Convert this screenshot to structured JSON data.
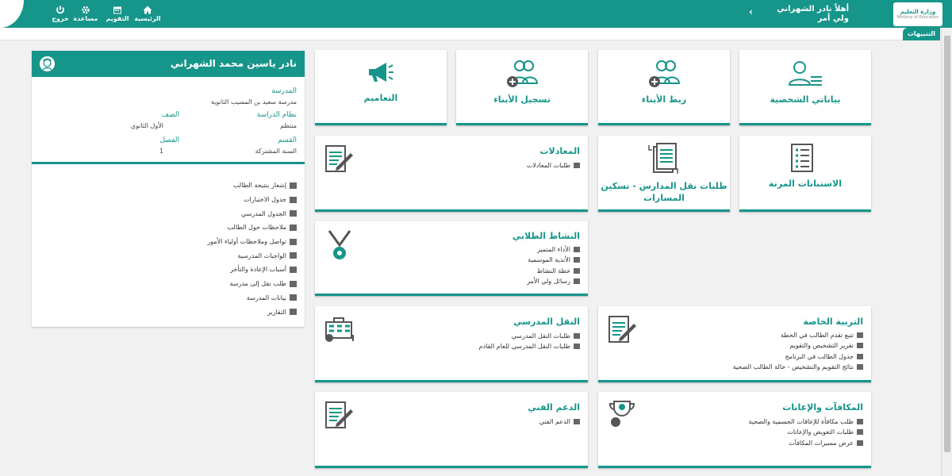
{
  "header": {
    "user_name": "أهلاً نادر الشهراني",
    "user_role": "ولي أمر",
    "logo_line1": "وزارة التعليم",
    "logo_line2": "Ministry of Education",
    "nav": [
      {
        "label": "الرئيسية",
        "icon": "home-icon"
      },
      {
        "label": "التقويم",
        "icon": "calendar-icon"
      },
      {
        "label": "مساعدة",
        "icon": "gear-icon"
      },
      {
        "label": "خروج",
        "icon": "power-icon"
      }
    ]
  },
  "subbar": {
    "alerts_label": "التنبيهات"
  },
  "profile": {
    "name": "نادر ياسين محمد الشهراني",
    "school_label": "المدرسة",
    "school_value": "مدرسة سعيد بن المسيب الثانوية",
    "system_label": "نظام الدراسة",
    "system_value": "منتظم",
    "grade_label": "الصف",
    "grade_value": "الأول الثانوي",
    "section_label": "القسم",
    "section_value": "السنة المشتركة",
    "class_label": "الفصل",
    "class_value": "1",
    "links": [
      "إشعار بنتيجة الطالب",
      "جدول الاختبارات",
      "الجدول المدرسي",
      "ملاحظات حول الطالب",
      "تواصل وملاحظات أولياء الأمور",
      "الواجبات المدرسية",
      "أسباب الإعادة والتأخر",
      "طلب نقل إلى مدرسة",
      "بيانات المدرسة",
      "التقارير"
    ]
  },
  "tiles": {
    "personal_data": "بياناتي الشخصية",
    "link_children": "ربط الأبناء",
    "register_children": "تسجيل الأبناء",
    "circulars": "التعاميم",
    "flexible_surveys": "الاستبانات المرنة",
    "transfer_requests": "طلبات نقل المدارس - تسكين المسارات"
  },
  "cards": {
    "equivalencies": {
      "title": "المعادلات",
      "items": [
        "طلبات المعادلات"
      ]
    },
    "activity": {
      "title": "النشاط الطلابي",
      "items": [
        "الأداء المتميز",
        "الأندية الموسمية",
        "خطة النشاط",
        "رسائل ولي الأمر"
      ]
    },
    "transport": {
      "title": "النقل المدرسي",
      "items": [
        "طلبات النقل المدرسي",
        "طلبات النقل المدرسي للعام القادم"
      ]
    },
    "special_ed": {
      "title": "التربية الخاصة",
      "items": [
        "تتبع تقدم الطالب في الخطة",
        "تقرير التشخيص والتقويم",
        "جدول الطالب في البرنامج",
        "نتائج التقويم والتشخيص - حالة الطالب الصحية"
      ]
    },
    "tech_support": {
      "title": "الدعم الفني",
      "items": [
        "الدعم الفني"
      ]
    },
    "rewards": {
      "title": "المكافآت والإعانات",
      "items": [
        "طلب مكافأة للإعاقات الجسمية والصحية",
        "طلبات التعويض والإعانات",
        "عرض مسيرات المكافآت"
      ]
    }
  },
  "colors": {
    "accent": "#16958a"
  }
}
